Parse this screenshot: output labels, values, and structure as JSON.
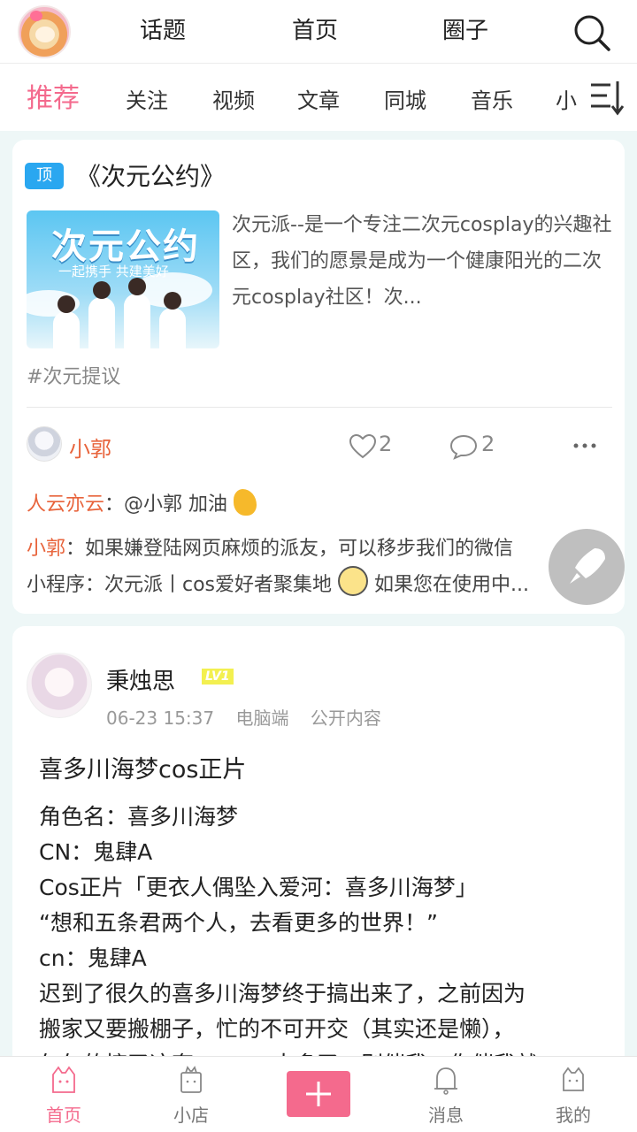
{
  "header": {
    "nav": [
      "话题",
      "首页",
      "圈子"
    ]
  },
  "tabs": [
    "推荐",
    "关注",
    "视频",
    "文章",
    "同城",
    "音乐",
    "小"
  ],
  "pinned_post": {
    "badge": "顶",
    "title": "《次元公约》",
    "thumb_title": "次元公约",
    "thumb_sub": "一起携手 共建美好",
    "description": "次元派--是一个专注二次元cosplay的兴趣社区，我们的愿景是成为一个健康阳光的二次元cosplay社区！次...",
    "hashtag": "#次元提议",
    "author": "小郭",
    "likes": "2",
    "comments": "2",
    "replies": [
      {
        "user": "人云亦云",
        "sep": "：",
        "text": "@小郭 加油"
      },
      {
        "user": "小郭",
        "sep": "：",
        "text": "如果嫌登陆网页麻烦的派友，可以移步我们的微信"
      },
      {
        "user": "",
        "sep": "",
        "text": "小程序：次元派丨cos爱好者聚集地",
        "text2": "如果您在使用中..."
      }
    ]
  },
  "post": {
    "author": "秉烛思",
    "level": "LV1",
    "date": "06-23 15:37",
    "device": "电脑端",
    "visibility": "公开内容",
    "title": "喜多川海梦cos正片",
    "lines": [
      "角色名：喜多川海梦",
      "CN：鬼肆A",
      "Cos正片「更衣人偶坠入爱河：喜多川海梦」",
      "“想和五条君两个人，去看更多的世界！”",
      "cn：鬼肆A",
      "迟到了很久的喜多川海梦终于搞出来了，之前因为",
      "搬家又要搬棚子，忙的不可开交（其实还是懒），",
      "匆匆的搞了这套，emm太多了，别催我，你催我就"
    ]
  },
  "bottom_nav": [
    "首页",
    "小店",
    "消息",
    "我的"
  ],
  "colors": {
    "accent": "#f46a8d",
    "username": "#e8643c",
    "pin": "#2aa7f0"
  }
}
